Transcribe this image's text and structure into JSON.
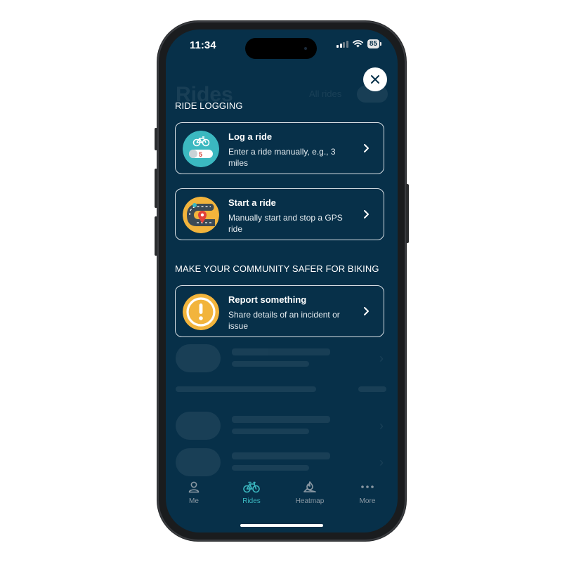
{
  "status_bar": {
    "time": "11:34",
    "battery": "85"
  },
  "background": {
    "title": "Rides",
    "filter": "All rides"
  },
  "sections": {
    "logging_title": "RIDE LOGGING",
    "community_title": "MAKE YOUR COMMUNITY SAFER FOR BIKING"
  },
  "cards": {
    "log": {
      "title": "Log a ride",
      "description": "Enter a ride manually, e.g., 3 miles",
      "icon": "log-ride-icon",
      "icon_number": "5"
    },
    "start": {
      "title": "Start a ride",
      "description": "Manually start and stop a GPS ride",
      "icon": "gps-ride-icon"
    },
    "report": {
      "title": "Report something",
      "description": "Share details of an incident or issue",
      "icon": "alert-icon"
    }
  },
  "tabs": [
    {
      "label": "Me",
      "icon": "person-icon",
      "active": false
    },
    {
      "label": "Rides",
      "icon": "bike-icon",
      "active": true
    },
    {
      "label": "Heatmap",
      "icon": "heatmap-icon",
      "active": false
    },
    {
      "label": "More",
      "icon": "more-icon",
      "active": false
    }
  ],
  "colors": {
    "background": "#073049",
    "accent": "#3bb8c0",
    "card_border": "#d7dee3",
    "tab_inactive": "#8a98a3",
    "icon_teal": "#3bb8c0",
    "icon_yellow": "#f2b43c"
  }
}
